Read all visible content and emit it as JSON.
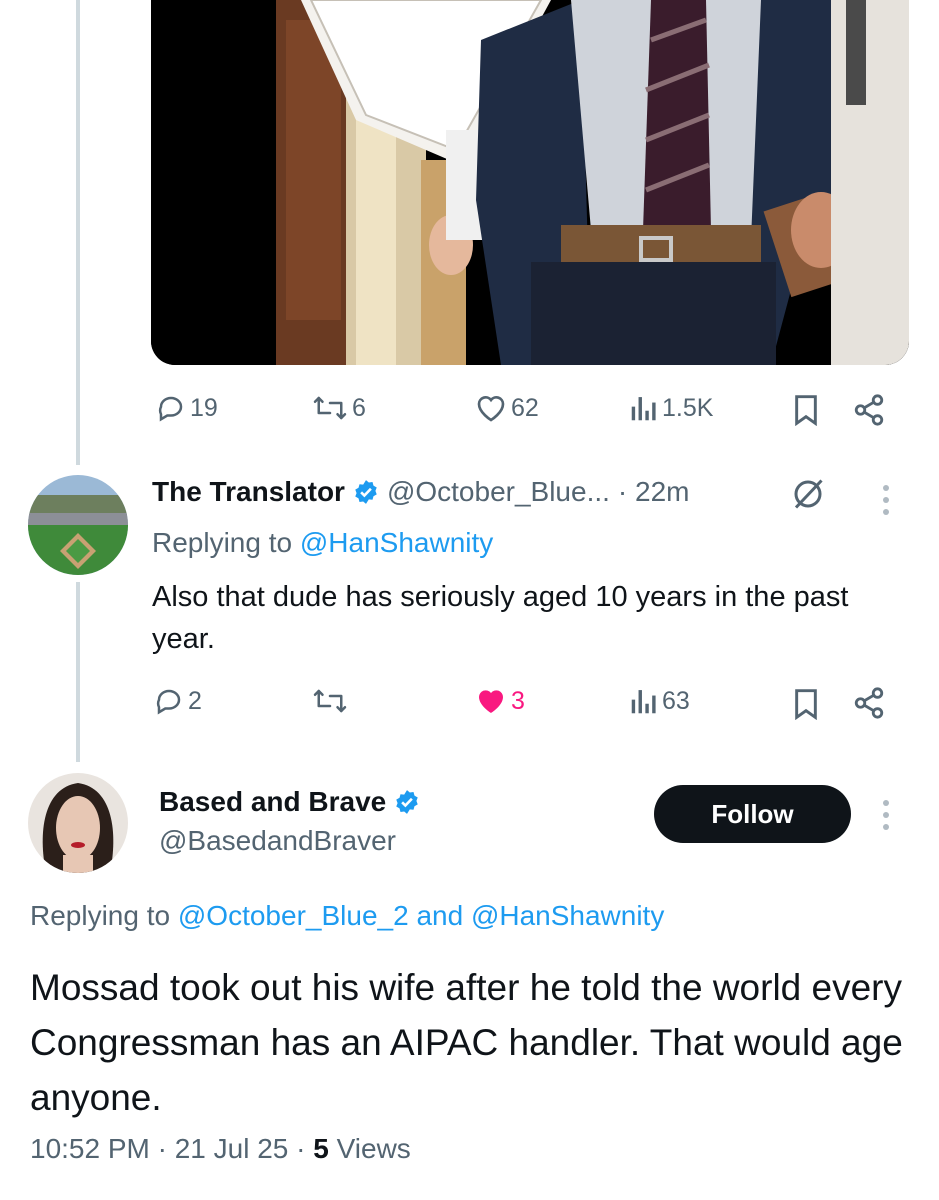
{
  "tweet1_actions": {
    "replies": "19",
    "retweets": "6",
    "likes": "62",
    "views": "1.5K"
  },
  "reply1": {
    "display_name": "The Translator",
    "handle": "@October_Blue...",
    "time": "· 22m",
    "replying_prefix": "Replying to",
    "replying_to": "@HanShawnity",
    "text": "Also that dude has seriously aged 10 years in the past year.",
    "actions": {
      "replies": "2",
      "retweets": "",
      "likes": "3",
      "views": "63"
    }
  },
  "reply2": {
    "display_name": "Based and Brave",
    "handle": "@BasedandBraver",
    "follow_label": "Follow",
    "replying_prefix": "Replying to",
    "replying_to_1": "@October_Blue_2",
    "replying_and": "and",
    "replying_to_2": "@HanShawnity",
    "text": "Mossad took out his wife after he told the world every Congressman has an AIPAC handler. That would age anyone.",
    "time": "10:52 PM · 21 Jul 25 ·",
    "views_count": "5",
    "views_label": "Views"
  },
  "colors": {
    "accent": "#1d9bf0",
    "like": "#f91880",
    "muted": "#536471",
    "verified": "#1d9bf0"
  }
}
